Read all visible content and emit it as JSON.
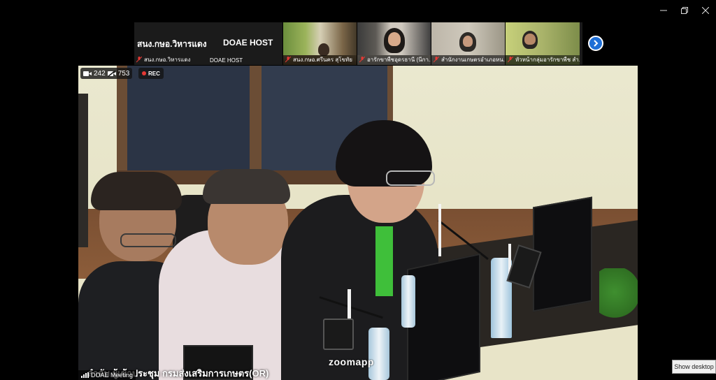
{
  "window": {
    "minimize_icon": "minimize-icon",
    "restore_icon": "restore-icon",
    "close_icon": "close-icon"
  },
  "gallery": {
    "host_tile": {
      "big_text_1": "สนง.กษอ.วิหารแดง",
      "big_text_2": "DOAE HOST",
      "label_1": "สนง.กษอ.วิหารแดง",
      "label_2": "DOAE HOST"
    },
    "tiles": [
      {
        "label": "สนง.กษอ.ศรีนคร สุโขทัย"
      },
      {
        "label": "อารักขาพืชอุดรธานี (นีกา..."
      },
      {
        "label": "สำนักงานเกษตรอำเภอหน..."
      },
      {
        "label": "หัวหน้ากลุ่มอารักขาพืช สำ..."
      }
    ],
    "next_icon": "chevron-right-icon"
  },
  "main_video": {
    "participants_count": "242",
    "hidden_count": "753",
    "rec_label": "REC",
    "caption": "ลำดับ ผู้เข้าประชุม กรมส่งเสริมการเกษตร(OR)",
    "watermark": "zoomapp",
    "bottom_name": "DOAE Meeting"
  },
  "taskbar": {
    "show_desktop": "Show desktop"
  },
  "colors": {
    "accent": "#1f6fd6",
    "rec": "#e53935",
    "mic_muted": "#e53935"
  }
}
